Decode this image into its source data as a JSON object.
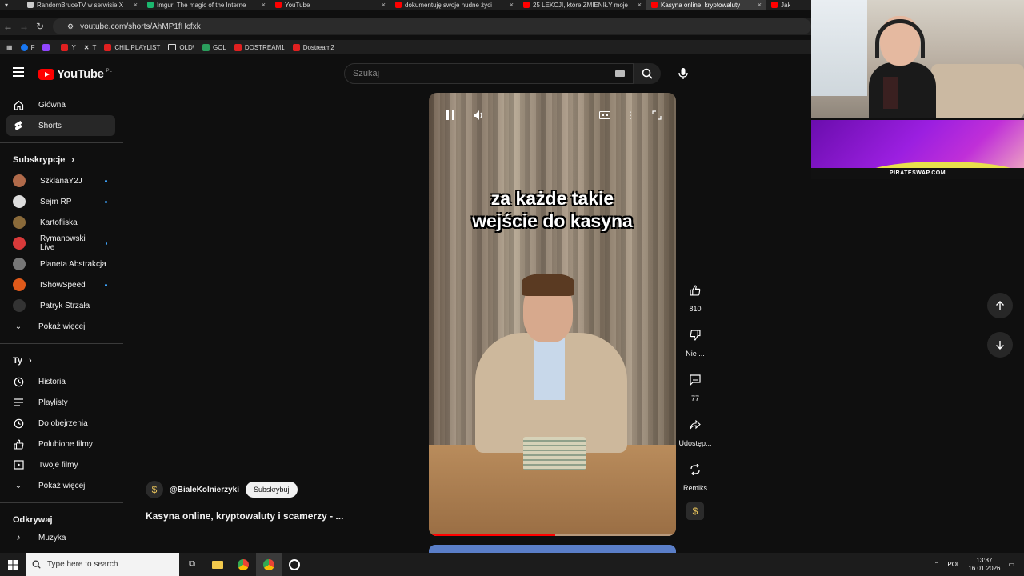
{
  "browser": {
    "tabs": [
      {
        "label": "RandomBruceTV w serwisie X",
        "color": "#cccccc",
        "active": false
      },
      {
        "label": "Imgur: The magic of the Interne",
        "color": "#1bb76e",
        "active": false
      },
      {
        "label": "YouTube",
        "color": "#ff0000",
        "active": false
      },
      {
        "label": "dokumentuję swoje nudne życi",
        "color": "#ff0000",
        "active": false
      },
      {
        "label": "25 LEKCJI, które ZMIENIŁY moje",
        "color": "#ff0000",
        "active": false
      },
      {
        "label": "Kasyna online, kryptowaluty",
        "color": "#ff0000",
        "active": true
      },
      {
        "label": "Jak",
        "color": "#ff0000",
        "active": false
      }
    ],
    "url": "youtube.com/shorts/AhMP1fHcfxk",
    "bookmarks": [
      "F",
      "",
      "Y",
      "T",
      "CHIL PLAYLIST",
      "OLD\\",
      "GOL",
      "DOSTREAM1",
      "Dostream2"
    ]
  },
  "youtube": {
    "logo_text": "YouTube",
    "country_code": "PL",
    "search_placeholder": "Szukaj"
  },
  "sidebar": {
    "main": [
      {
        "label": "Główna",
        "icon": "home-icon"
      },
      {
        "label": "Shorts",
        "icon": "shorts-icon"
      }
    ],
    "subs_heading": "Subskrypcje",
    "subscriptions": [
      {
        "label": "SzklanaY2J",
        "color": "#b06a4a",
        "dot": true
      },
      {
        "label": "Sejm RP",
        "color": "#dddddd",
        "dot": true
      },
      {
        "label": "Kartofliska",
        "color": "#8a6a3a",
        "dot": false
      },
      {
        "label": "Rymanowski Live",
        "color": "#d83a3a",
        "dot": true
      },
      {
        "label": "Planeta Abstrakcja",
        "color": "#777777",
        "dot": false
      },
      {
        "label": "IShowSpeed",
        "color": "#e05a1a",
        "dot": true
      },
      {
        "label": "Patryk Strzała",
        "color": "#333333",
        "dot": false
      }
    ],
    "subs_more": "Pokaż więcej",
    "you_heading": "Ty",
    "you_items": [
      {
        "label": "Historia",
        "icon": "history-icon"
      },
      {
        "label": "Playlisty",
        "icon": "playlist-icon"
      },
      {
        "label": "Do obejrzenia",
        "icon": "clock-icon"
      },
      {
        "label": "Polubione filmy",
        "icon": "thumb-up-icon"
      },
      {
        "label": "Twoje filmy",
        "icon": "video-icon"
      }
    ],
    "you_more": "Pokaż więcej",
    "explore_heading": "Odkrywaj",
    "explore_first": "Muzyka"
  },
  "video": {
    "caption_line1": "za każde takie",
    "caption_line2": "wejście do kasyna",
    "progress": 0.51,
    "channel": "@BialeKolnierzyki",
    "subscribe_label": "Subskrybuj",
    "title": "Kasyna online, kryptowaluty i scamerzy - ...",
    "likes": "810",
    "dislike_label": "Nie ...",
    "comments": "77",
    "share_label": "Udostęp...",
    "remix_label": "Remiks"
  },
  "overlay": {
    "banner_text": "PIRATESWAP.COM"
  },
  "taskbar": {
    "search_placeholder": "Type here to search",
    "lang": "POL",
    "time": "13:37",
    "date": "16.01.2026"
  }
}
